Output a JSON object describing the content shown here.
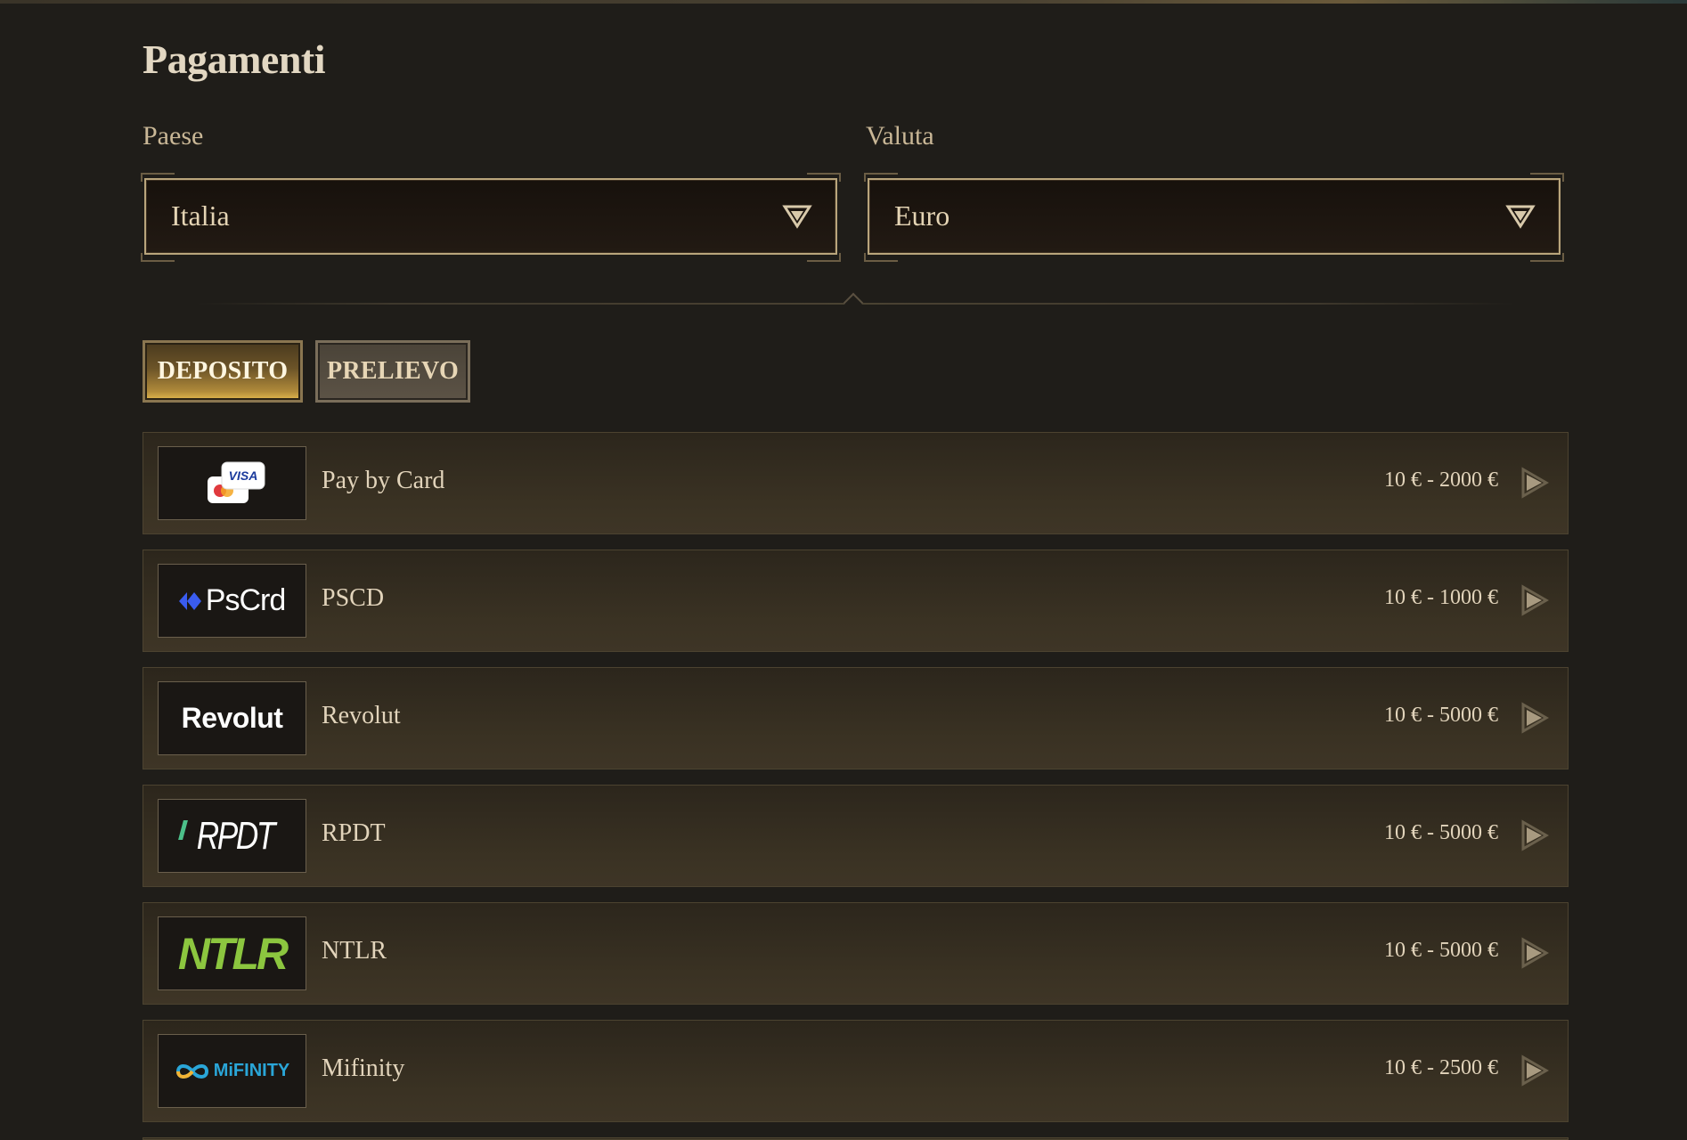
{
  "page": {
    "title": "Pagamenti"
  },
  "filters": {
    "country_label": "Paese",
    "country_value": "Italia",
    "currency_label": "Valuta",
    "currency_value": "Euro"
  },
  "tabs": [
    {
      "label": "DEPOSITO",
      "active": true
    },
    {
      "label": "PRELIEVO",
      "active": false
    }
  ],
  "methods": [
    {
      "name": "Pay by Card",
      "range": "10 € - 2000 €",
      "logo": "card-logo",
      "logo_text": "VISA"
    },
    {
      "name": "PSCD",
      "range": "10 € - 1000 €",
      "logo": "pscrd-logo",
      "logo_text": "PsCrd"
    },
    {
      "name": "Revolut",
      "range": "10 € - 5000 €",
      "logo": "revolut-logo",
      "logo_text": "Revolut"
    },
    {
      "name": "RPDT",
      "range": "10 € - 5000 €",
      "logo": "rpdt-logo",
      "logo_text": "RPDT"
    },
    {
      "name": "NTLR",
      "range": "10 € - 5000 €",
      "logo": "ntlr-logo",
      "logo_text": "NTLR"
    },
    {
      "name": "Mifinity",
      "range": "10 € - 2500 €",
      "logo": "mifinity-logo",
      "logo_text": "MiFINITY"
    }
  ],
  "colors": {
    "background": "#1f1d19",
    "accent_gold": "#e3b84e",
    "pscrd_blue": "#3a5cf0",
    "ntlr_green": "#8cc63f",
    "mifinity_blue": "#2aa6d8"
  }
}
